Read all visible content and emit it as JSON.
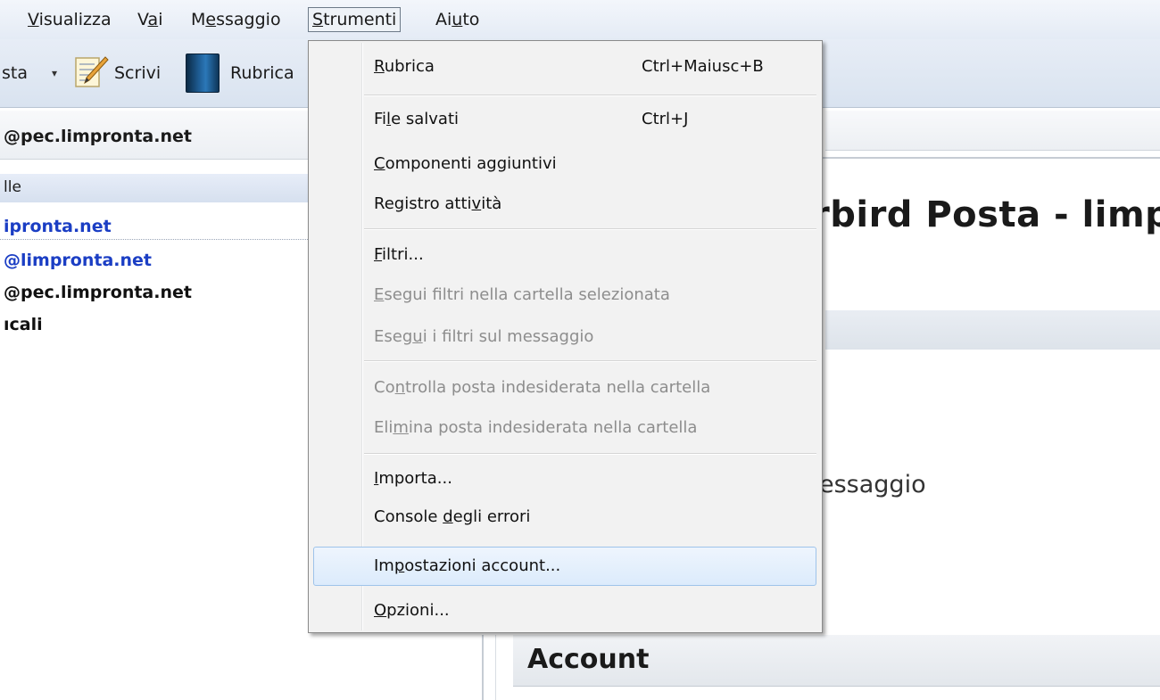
{
  "menubar": {
    "items": [
      {
        "pre": "",
        "ul": "V",
        "post": "isualizza"
      },
      {
        "pre": "V",
        "ul": "a",
        "post": "i"
      },
      {
        "pre": "M",
        "ul": "e",
        "post": "ssaggio"
      },
      {
        "pre": "",
        "ul": "S",
        "post": "trumenti"
      },
      {
        "pre": "Ai",
        "ul": "u",
        "post": "to"
      }
    ]
  },
  "toolbar": {
    "partial_label": "sta",
    "dropdown_arrow": "▾",
    "scrivi_label": "Scrivi",
    "rubrica_label": "Rubrica"
  },
  "sidebar": {
    "account_title": "@pec.limpronta.net",
    "header_label": "lle",
    "folders": [
      {
        "label": "ipronta.net"
      },
      {
        "label": "@limpronta.net"
      },
      {
        "label": "@pec.limpronta.net"
      },
      {
        "label": "ıcali"
      }
    ]
  },
  "content": {
    "title_partial": "rbird Posta - limp",
    "text_partial": "essaggio",
    "account_heading": "Account"
  },
  "tools_menu": {
    "items": [
      {
        "pre": "",
        "ul": "R",
        "post": "ubrica",
        "shortcut": "Ctrl+Maiusc+B",
        "disabled": false
      },
      {
        "pre": "Fi",
        "ul": "l",
        "post": "e salvati",
        "shortcut": "Ctrl+J",
        "disabled": false
      },
      {
        "pre": "",
        "ul": "C",
        "post": "omponenti aggiuntivi",
        "shortcut": "",
        "disabled": false
      },
      {
        "pre": "Registro atti",
        "ul": "v",
        "post": "ità",
        "shortcut": "",
        "disabled": false
      },
      {
        "pre": "",
        "ul": "F",
        "post": "iltri...",
        "shortcut": "",
        "disabled": false
      },
      {
        "pre": "",
        "ul": "E",
        "post": "segui filtri nella cartella selezionata",
        "shortcut": "",
        "disabled": true
      },
      {
        "pre": "Eseg",
        "ul": "u",
        "post": "i i filtri sul messaggio",
        "shortcut": "",
        "disabled": true
      },
      {
        "pre": "Co",
        "ul": "n",
        "post": "trolla posta indesiderata nella cartella",
        "shortcut": "",
        "disabled": true
      },
      {
        "pre": "Eli",
        "ul": "m",
        "post": "ina posta indesiderata nella cartella",
        "shortcut": "",
        "disabled": true
      },
      {
        "pre": "",
        "ul": "I",
        "post": "mporta...",
        "shortcut": "",
        "disabled": false
      },
      {
        "pre": "Console ",
        "ul": "d",
        "post": "egli errori",
        "shortcut": "",
        "disabled": false
      },
      {
        "pre": "Im",
        "ul": "p",
        "post": "ostazioni account...",
        "shortcut": "",
        "disabled": false,
        "highlighted": true
      },
      {
        "pre": "",
        "ul": "O",
        "post": "pzioni...",
        "shortcut": "",
        "disabled": false
      }
    ]
  }
}
